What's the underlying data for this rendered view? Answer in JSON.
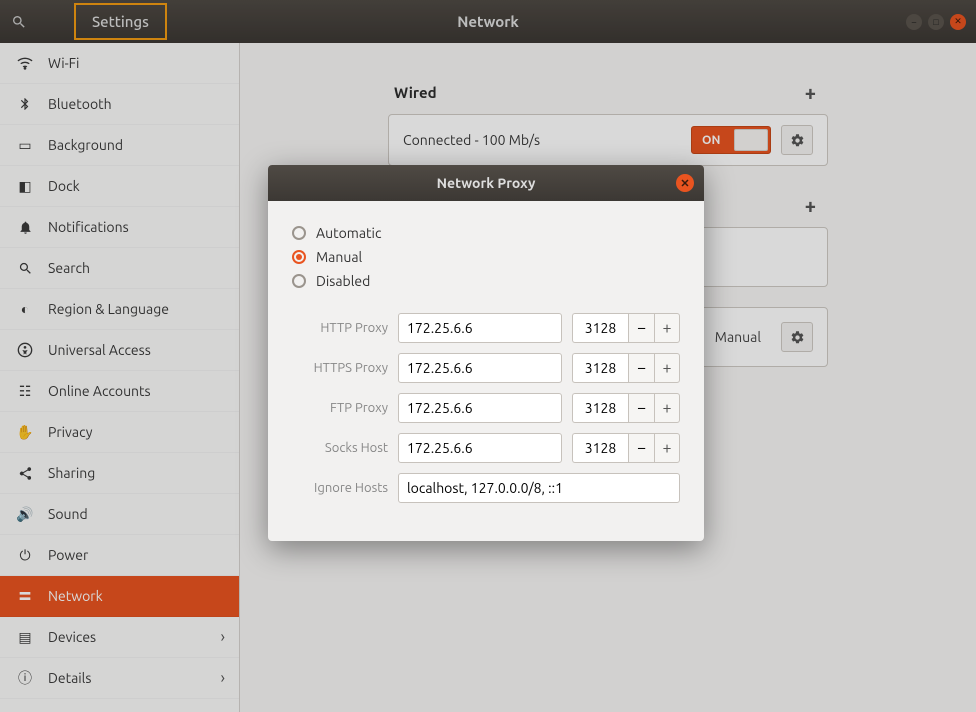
{
  "header": {
    "app_name": "Settings",
    "window_title": "Network"
  },
  "sidebar": {
    "items": [
      {
        "label": "Wi-Fi",
        "icon": "wifi"
      },
      {
        "label": "Bluetooth",
        "icon": "bt"
      },
      {
        "label": "Background",
        "icon": "bg"
      },
      {
        "label": "Dock",
        "icon": "dock"
      },
      {
        "label": "Notifications",
        "icon": "bell"
      },
      {
        "label": "Search",
        "icon": "search"
      },
      {
        "label": "Region & Language",
        "icon": "rl"
      },
      {
        "label": "Universal Access",
        "icon": "ua"
      },
      {
        "label": "Online Accounts",
        "icon": "oa"
      },
      {
        "label": "Privacy",
        "icon": "priv"
      },
      {
        "label": "Sharing",
        "icon": "share"
      },
      {
        "label": "Sound",
        "icon": "snd"
      },
      {
        "label": "Power",
        "icon": "pwr"
      },
      {
        "label": "Network",
        "icon": "net",
        "active": true
      },
      {
        "label": "Devices",
        "icon": "dev",
        "chevron": true
      },
      {
        "label": "Details",
        "icon": "det",
        "chevron": true
      }
    ]
  },
  "content": {
    "wired_label": "Wired",
    "wired_status": "Connected - 100 Mb/s",
    "switch_on": "ON",
    "proxy_section_value": "Manual"
  },
  "dialog": {
    "title": "Network Proxy",
    "radios": [
      "Automatic",
      "Manual",
      "Disabled"
    ],
    "selected_radio": "Manual",
    "rows": [
      {
        "label": "HTTP Proxy",
        "host": "172.25.6.6",
        "port": "3128"
      },
      {
        "label": "HTTPS Proxy",
        "host": "172.25.6.6",
        "port": "3128"
      },
      {
        "label": "FTP Proxy",
        "host": "172.25.6.6",
        "port": "3128"
      },
      {
        "label": "Socks Host",
        "host": "172.25.6.6",
        "port": "3128"
      }
    ],
    "ignore_label": "Ignore Hosts",
    "ignore_value": "localhost, 127.0.0.0/8, ::1"
  }
}
